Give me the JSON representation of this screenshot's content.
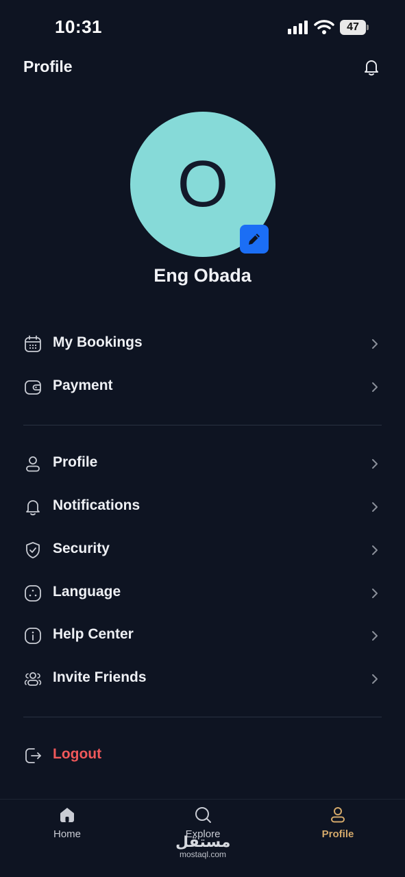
{
  "status_bar": {
    "time": "10:31",
    "battery": "47"
  },
  "header": {
    "title": "Profile",
    "icon": "bell-icon"
  },
  "profile": {
    "initial": "O",
    "name": "Eng Obada",
    "avatar_color": "#86dad8",
    "edit_icon": "pencil-icon"
  },
  "menu_group_1": [
    {
      "label": "My Bookings",
      "icon": "calendar-icon"
    },
    {
      "label": "Payment",
      "icon": "wallet-icon"
    }
  ],
  "menu_group_2": [
    {
      "label": "Profile",
      "icon": "user-icon"
    },
    {
      "label": "Notifications",
      "icon": "bell-icon"
    },
    {
      "label": "Security",
      "icon": "shield-check-icon"
    },
    {
      "label": "Language",
      "icon": "language-icon"
    },
    {
      "label": "Help Center",
      "icon": "info-icon"
    },
    {
      "label": "Invite Friends",
      "icon": "users-icon"
    }
  ],
  "logout": {
    "label": "Logout",
    "icon": "logout-icon",
    "color": "#f0585a"
  },
  "bottom_nav": [
    {
      "label": "Home",
      "icon": "home-icon",
      "active": false
    },
    {
      "label": "Explore",
      "icon": "search-icon",
      "active": false
    },
    {
      "label": "Profile",
      "icon": "user-icon",
      "active": true
    }
  ],
  "watermark": {
    "arabic": "مستقل",
    "site": "mostaql.com"
  },
  "colors": {
    "background": "#0e1422",
    "accent_active": "#d4a96a",
    "edit_button": "#1b6ef5"
  }
}
